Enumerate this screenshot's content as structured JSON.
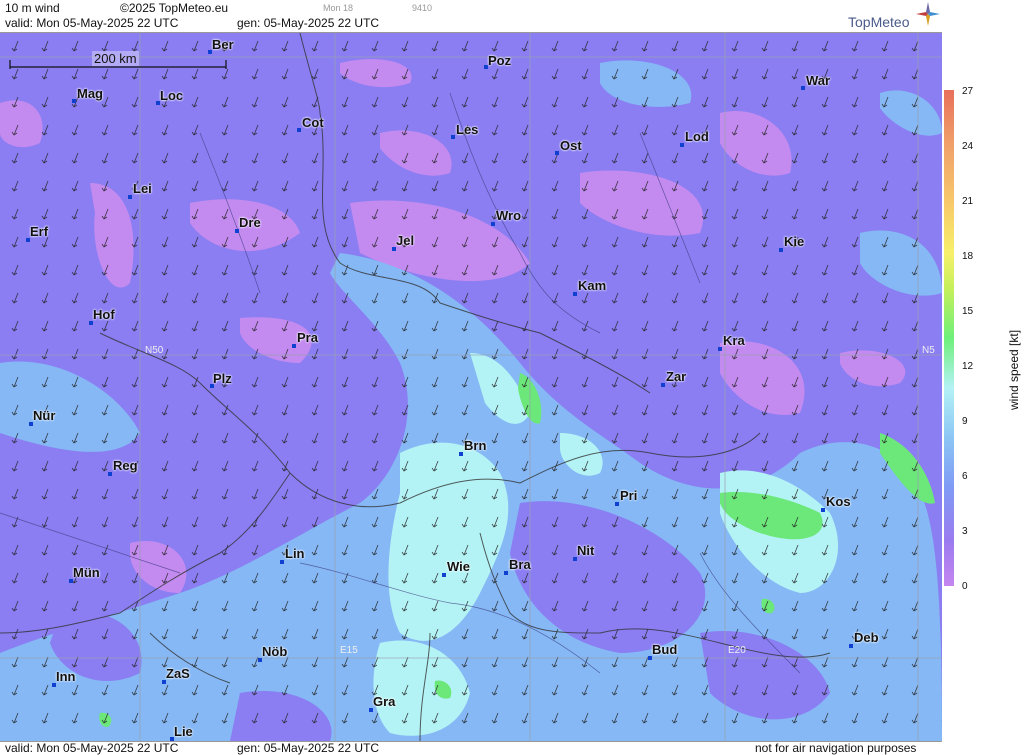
{
  "header": {
    "product": "10 m wind",
    "copyright": "©2025 TopMeteo.eu",
    "run": "Mon 18",
    "code": "9410",
    "valid": "valid:  Mon  05-May-2025  22 UTC",
    "gen": "gen: 05-May-2025 22 UTC",
    "brand": "TopMeteo"
  },
  "footer": {
    "valid": "valid:  Mon  05-May-2025  22 UTC",
    "gen": "gen: 05-May-2025 22 UTC",
    "notice": "not for air navigation purposes"
  },
  "scale": {
    "label": "200 km"
  },
  "legend": {
    "unit": "wind  speed  [kt]",
    "ticks": [
      "27",
      "24",
      "21",
      "18",
      "15",
      "12",
      "9",
      "6",
      "3",
      "0"
    ],
    "colors": [
      "#c586f0",
      "#9b7bf0",
      "#7f9bf5",
      "#8cc6f5",
      "#b3f2f5",
      "#6ef07a",
      "#c5f05a",
      "#f7f06a",
      "#f7c66a",
      "#f0a06a",
      "#e8705a"
    ]
  },
  "grid_labels": {
    "n50": "N50",
    "e15": "E15",
    "e20": "E20",
    "n50_right": "N5"
  },
  "cities": [
    {
      "name": "Ber"
    },
    {
      "name": "Poz"
    },
    {
      "name": "War"
    },
    {
      "name": "Mag"
    },
    {
      "name": "Loc"
    },
    {
      "name": "Cot"
    },
    {
      "name": "Les"
    },
    {
      "name": "Ost"
    },
    {
      "name": "Lod"
    },
    {
      "name": "Lei"
    },
    {
      "name": "Dre"
    },
    {
      "name": "Wro"
    },
    {
      "name": "Erf"
    },
    {
      "name": "Jel"
    },
    {
      "name": "Kie"
    },
    {
      "name": "Kam"
    },
    {
      "name": "Hof"
    },
    {
      "name": "Pra"
    },
    {
      "name": "Kra"
    },
    {
      "name": "Plz"
    },
    {
      "name": "Zar"
    },
    {
      "name": "Nür"
    },
    {
      "name": "Brn"
    },
    {
      "name": "Reg"
    },
    {
      "name": "Pri"
    },
    {
      "name": "Kos"
    },
    {
      "name": "Lin"
    },
    {
      "name": "Nit"
    },
    {
      "name": "Wie"
    },
    {
      "name": "Bra"
    },
    {
      "name": "Mün"
    },
    {
      "name": "Deb"
    },
    {
      "name": "Nöb"
    },
    {
      "name": "Bud"
    },
    {
      "name": "ZaS"
    },
    {
      "name": "Inn"
    },
    {
      "name": "Gra"
    },
    {
      "name": "Lie"
    }
  ]
}
